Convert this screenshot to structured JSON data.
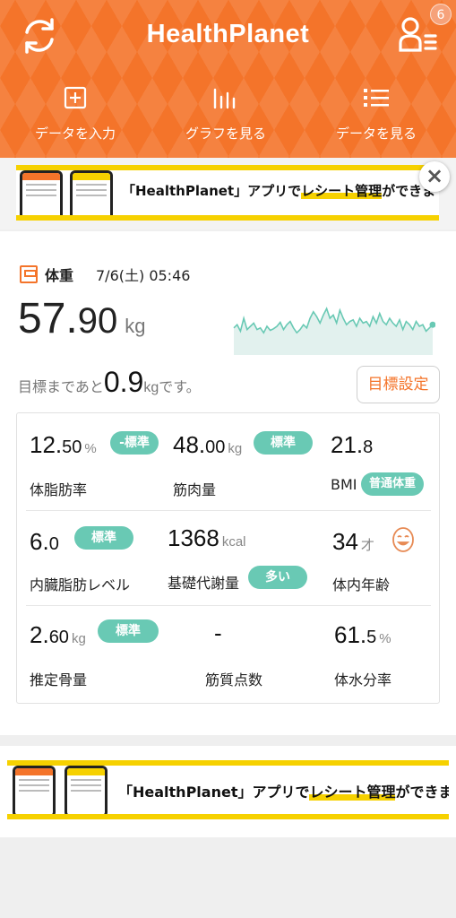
{
  "header": {
    "title": "HealthPlanet",
    "notification_count": "6",
    "nav": [
      {
        "label": "データを入力",
        "icon": "plus-square-icon"
      },
      {
        "label": "グラフを見る",
        "icon": "bar-graph-icon"
      },
      {
        "label": "データを見る",
        "icon": "list-icon"
      }
    ],
    "accent": "#f4742a"
  },
  "banner": {
    "text_pre": "「HealthPlanet」アプリで",
    "text_hl": "レシート管理",
    "text_post": "ができます!",
    "close": "×"
  },
  "weight": {
    "label": "体重",
    "date": "7/6(土) 05:46",
    "value_int": "57.",
    "value_dec": "90",
    "unit": "kg",
    "goal_prefix": "目標まであと",
    "goal_value": "0.9",
    "goal_suffix": "kgです。",
    "goal_button": "目標設定",
    "trend_series": [
      42,
      38,
      46,
      30,
      44,
      40,
      36,
      44,
      42,
      48,
      40,
      45,
      43,
      40,
      35,
      44,
      38,
      34,
      42,
      48,
      44,
      38,
      42,
      30,
      22,
      28,
      36,
      26,
      18,
      30,
      26,
      36,
      20,
      30,
      38,
      34,
      32,
      40,
      30,
      36,
      34,
      40,
      28,
      36,
      24,
      34,
      38,
      30,
      36,
      40,
      32,
      44,
      34,
      38,
      44,
      34,
      40,
      38,
      46,
      42,
      38
    ]
  },
  "metrics": {
    "body_fat": {
      "int": "12.",
      "dec": "50",
      "unit": "%",
      "badge": "-標準",
      "label": "体脂肪率"
    },
    "muscle": {
      "int": "48.",
      "dec": "00",
      "unit": "kg",
      "badge": "標準",
      "label": "筋肉量"
    },
    "bmi": {
      "int": "21.",
      "dec": "8",
      "badge": "普通体重",
      "label": "BMI"
    },
    "visceral": {
      "int": "6.",
      "dec": "0",
      "badge": "標準",
      "label": "内臓脂肪レベル"
    },
    "bmr": {
      "value": "1368",
      "unit": "kcal",
      "badge": "多い",
      "label": "基礎代謝量"
    },
    "body_age": {
      "value": "34",
      "unit": "才",
      "label": "体内年齢"
    },
    "bone": {
      "int": "2.",
      "dec": "60",
      "unit": "kg",
      "badge": "標準",
      "label": "推定骨量"
    },
    "muscle_quality": {
      "value": "-",
      "label": "筋質点数"
    },
    "water": {
      "int": "61.",
      "dec": "5",
      "unit": "%",
      "label": "体水分率"
    },
    "badge_color": "#69c9b4"
  }
}
